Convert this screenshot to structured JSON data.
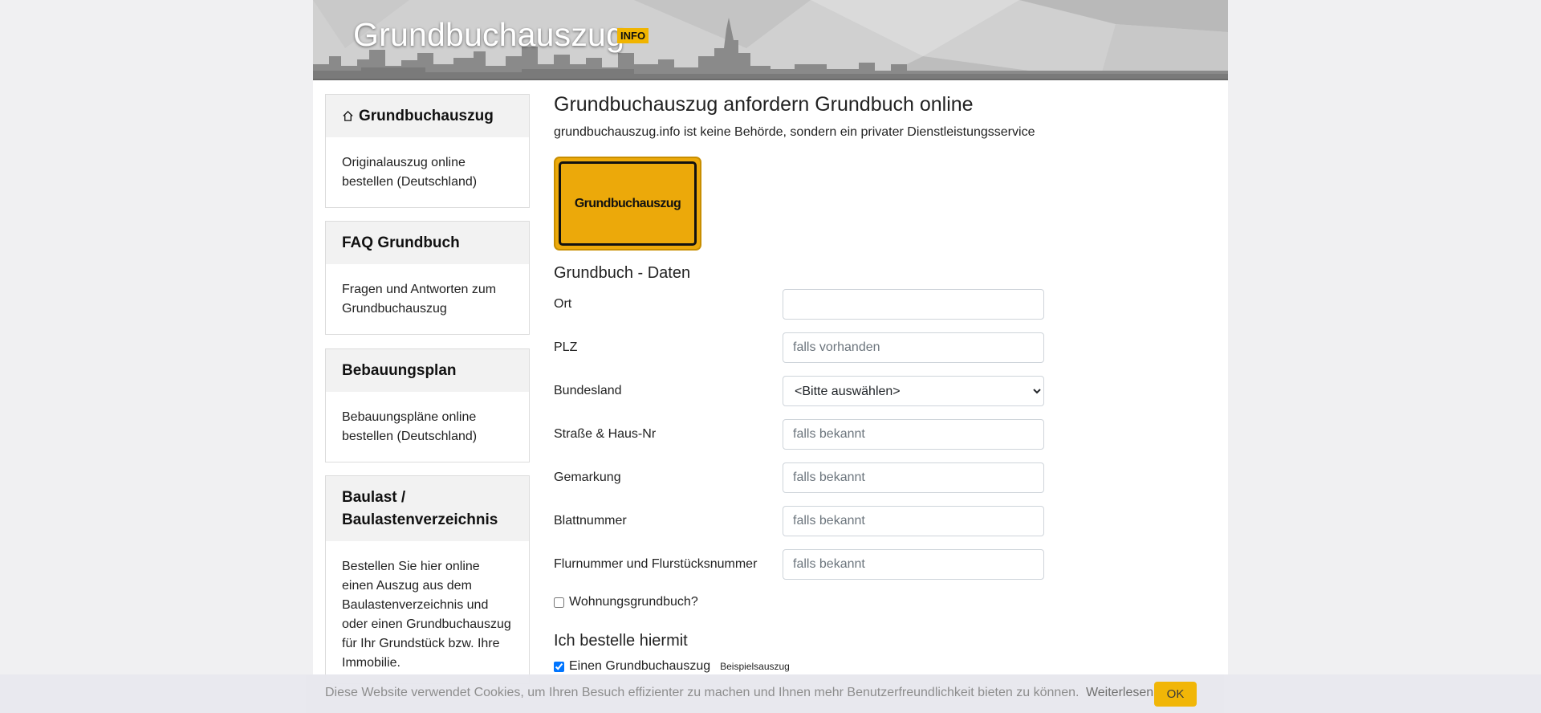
{
  "header": {
    "site_title": "Grundbuchauszug",
    "badge": "INFO"
  },
  "sidebar": {
    "cards": [
      {
        "title": "Grundbuchauszug",
        "icon": "home-icon",
        "body": "Originalauszug online bestellen (Deutschland)"
      },
      {
        "title": "FAQ Grundbuch",
        "body": "Fragen und Antworten zum Grundbuchauszug"
      },
      {
        "title": "Bebauungsplan",
        "body": "Bebauungspläne online bestellen (Deutschland)"
      },
      {
        "title": "Baulast / Baulastenverzeichnis",
        "body": "Bestellen Sie hier online einen Auszug aus dem Baulastenverzeichnis und oder einen Grundbuchauszug für Ihr Grundstück bzw. Ihre Immobilie."
      }
    ]
  },
  "main": {
    "title": "Grundbuchauszug anfordern Grundbuch online",
    "subtitle": "grundbuchauszug.info ist keine Behörde, sondern ein privater Dienstleistungsservice",
    "logo_text": "Grundbuchauszug",
    "section_title": "Grundbuch - Daten",
    "fields": {
      "ort": {
        "label": "Ort",
        "value": "",
        "placeholder": ""
      },
      "plz": {
        "label": "PLZ",
        "placeholder": "falls vorhanden"
      },
      "bundesland": {
        "label": "Bundesland",
        "selected": "<Bitte auswählen>"
      },
      "strasse": {
        "label": "Straße & Haus-Nr",
        "placeholder": "falls bekannt"
      },
      "gemarkung": {
        "label": "Gemarkung",
        "placeholder": "falls bekannt"
      },
      "blattnummer": {
        "label": "Blattnummer",
        "placeholder": "falls bekannt"
      },
      "flurnummer": {
        "label": "Flurnummer und Flurstücksnummer",
        "placeholder": "falls bekannt"
      }
    },
    "wohnungsgrundbuch": {
      "label": "Wohnungsgrundbuch?",
      "checked": false
    },
    "order_title": "Ich bestelle hiermit",
    "order_item": {
      "label": "Einen Grundbuchauszug",
      "checked": true,
      "example_link": "Beispielsauszug"
    }
  },
  "cookie": {
    "text": "Diese Website verwendet Cookies, um Ihren Besuch effizienter zu machen und Ihnen mehr Benutzerfreundlichkeit bieten zu können.",
    "link": "Weiterlesen",
    "ok": "OK"
  },
  "colors": {
    "accent": "#f1b400",
    "header_bg": "#d3d3d3",
    "page_bg": "#f0f0f2"
  }
}
